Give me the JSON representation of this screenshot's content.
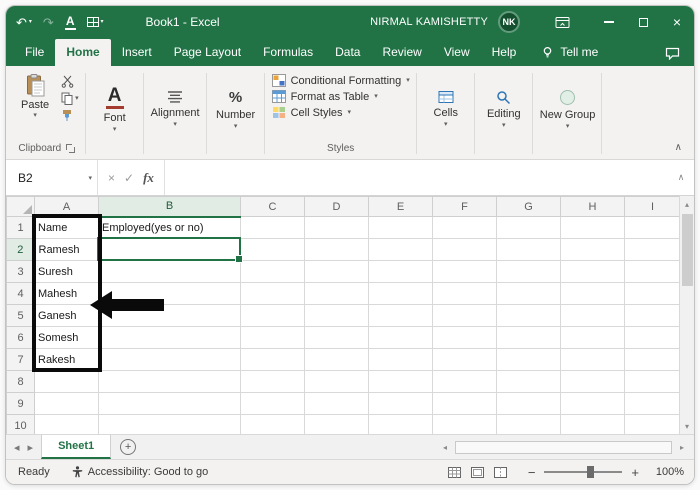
{
  "icons": {
    "undo": "↶",
    "redo": "↷",
    "dropdown": "▾",
    "close": "×",
    "cancel": "×",
    "check": "✓",
    "collapse": "∧",
    "scroll_up": "▴",
    "scroll_down": "▾",
    "scroll_left": "◂",
    "scroll_right": "▸",
    "add_sheet": "+",
    "zoom_out": "−",
    "zoom_in": "+"
  },
  "title_bar": {
    "title": "Book1 - Excel",
    "underline_letter": "A",
    "user": {
      "name": "NIRMAL KAMISHETTY",
      "initials": "NK"
    }
  },
  "menu_bar": {
    "tabs": [
      "File",
      "Home",
      "Insert",
      "Page Layout",
      "Formulas",
      "Data",
      "Review",
      "View",
      "Help"
    ],
    "active_tab": "Home",
    "tell_me": "Tell me"
  },
  "ribbon": {
    "clipboard": {
      "paste": "Paste",
      "label": "Clipboard"
    },
    "font": {
      "button": "A",
      "label": "Font"
    },
    "alignment": {
      "label": "Alignment"
    },
    "number": {
      "symbol": "%",
      "label": "Number"
    },
    "styles": {
      "items": [
        "Conditional Formatting",
        "Format as Table",
        "Cell Styles"
      ],
      "label": "Styles"
    },
    "cells": {
      "label": "Cells"
    },
    "editing": {
      "label": "Editing"
    },
    "new_group": {
      "label": "New Group"
    }
  },
  "formula_bar": {
    "name_box": "B2",
    "fx": "fx",
    "value": ""
  },
  "grid": {
    "columns": [
      "A",
      "B",
      "C",
      "D",
      "E",
      "F",
      "G",
      "H",
      "I"
    ],
    "row_count": 10,
    "selected_cell": "B2",
    "selected_column": "B",
    "selected_row": "2",
    "cells": [
      {
        "ref": "A1",
        "text": "Name"
      },
      {
        "ref": "A2",
        "text": "Ramesh"
      },
      {
        "ref": "A3",
        "text": "Suresh"
      },
      {
        "ref": "A4",
        "text": "Mahesh"
      },
      {
        "ref": "A5",
        "text": "Ganesh"
      },
      {
        "ref": "A6",
        "text": "Somesh"
      },
      {
        "ref": "A7",
        "text": "Rakesh"
      },
      {
        "ref": "B1",
        "text": "Employed(yes or no)"
      }
    ]
  },
  "sheet_bar": {
    "tabs": [
      {
        "label": "Sheet1",
        "active": true
      }
    ]
  },
  "status_bar": {
    "mode": "Ready",
    "accessibility": "Accessibility: Good to go",
    "zoom": "100%"
  },
  "colors": {
    "excel_green": "#217346",
    "selection_green": "#217346",
    "annotation_black": "#0a0a0a"
  }
}
